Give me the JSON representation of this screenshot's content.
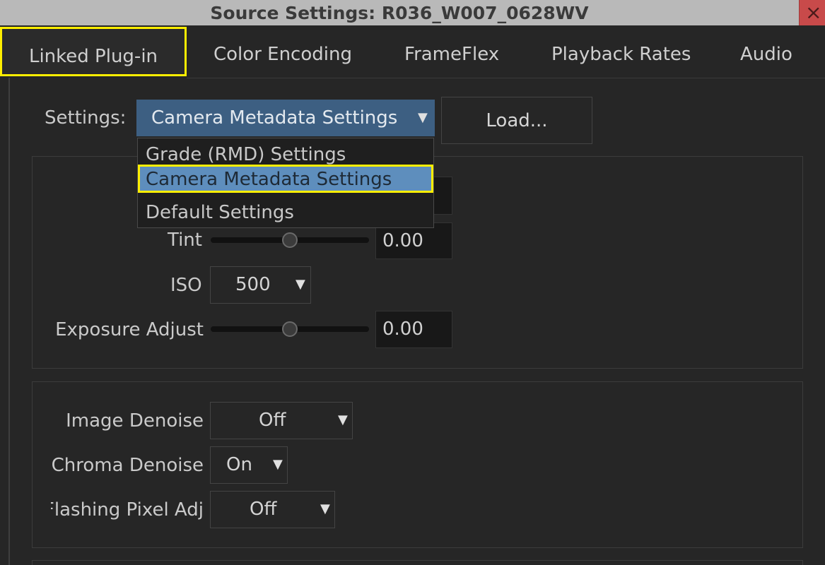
{
  "window": {
    "title": "Source Settings: R036_W007_0628WV",
    "close_glyph": "×"
  },
  "tabs": [
    {
      "label": "Linked Plug-in",
      "active": true
    },
    {
      "label": "Color Encoding"
    },
    {
      "label": "FrameFlex"
    },
    {
      "label": "Playback Rates"
    },
    {
      "label": "Audio"
    }
  ],
  "settings": {
    "label": "Settings:",
    "selected": "Camera Metadata Settings",
    "options": [
      "Grade (RMD) Settings",
      "Camera Metadata Settings",
      "Default Settings"
    ],
    "load_label": "Load..."
  },
  "color": {
    "tint": {
      "label": "Tint",
      "value": "0.00",
      "slider": 0.5
    },
    "iso": {
      "label": "ISO",
      "value": "500"
    },
    "exposure": {
      "label": "Exposure Adjust",
      "value": "0.00",
      "slider": 0.5
    }
  },
  "denoise": {
    "image": {
      "label": "Image Denoise",
      "value": "Off"
    },
    "chroma": {
      "label": "Chroma Denoise",
      "value": "On"
    },
    "flashing": {
      "label": "Flashing Pixel Adj",
      "value": "Off"
    }
  },
  "colors": {
    "accent_highlight": "#ffee00",
    "select_blue": "#3d5f82",
    "selected_item_blue": "#5e8ebd",
    "close_red": "#c84a4a"
  },
  "icons": {
    "caret": "▼"
  }
}
